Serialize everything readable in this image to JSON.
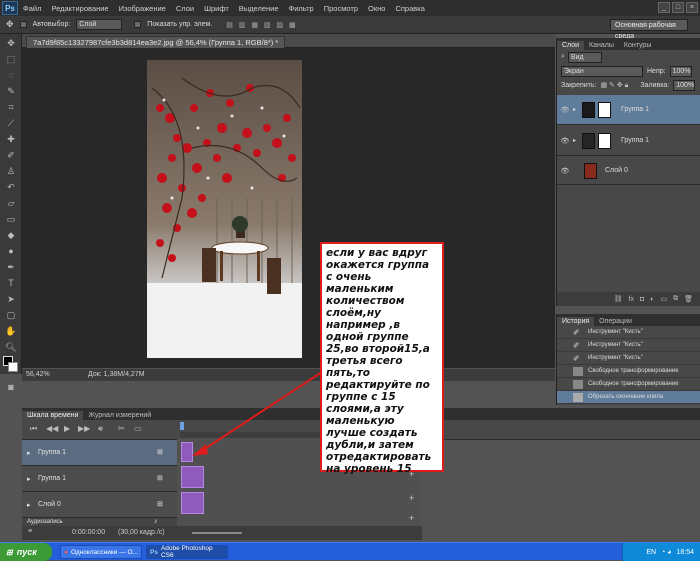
{
  "app": {
    "logo": "Ps"
  },
  "menu": [
    "Файл",
    "Редактирование",
    "Изображение",
    "Слои",
    "Шрифт",
    "Выделение",
    "Фильтр",
    "Просмотр",
    "Окно",
    "Справка"
  ],
  "options_bar": {
    "auto_select_label": "Автовыбор:",
    "auto_select_value": "Слой",
    "show_controls_label": "Показать упр. элем.",
    "workspace": "Основная рабочая среда"
  },
  "document": {
    "tab_title": "7a7d9f85c13327987cfe3b3d814ea3e2.jpg @ 56,4% (Группа 1, RGB/8*) *",
    "zoom": "56,42%",
    "doc_size": "Док: 1,38M/4,27M"
  },
  "layers_panel": {
    "tabs": [
      "Слои",
      "Каналы",
      "Контуры"
    ],
    "kind_label": "Вид",
    "blend_mode": "Экран",
    "opacity_label": "Непр:",
    "opacity_value": "100%",
    "lock_label": "Закрепить:",
    "fill_label": "Заливка:",
    "fill_value": "100%",
    "layers": [
      {
        "name": "Группа 1"
      },
      {
        "name": "Группа 1"
      },
      {
        "name": "Слой 0"
      }
    ],
    "footer_icons": [
      "link-icon",
      "fx-icon",
      "mask-icon",
      "adjustment-icon",
      "folder-icon",
      "new-layer-icon",
      "trash-icon"
    ]
  },
  "history_panel": {
    "tabs": [
      "История",
      "Операции"
    ],
    "items": [
      {
        "label": "Инструмент \"Кисть\"",
        "icon": "brush-icon"
      },
      {
        "label": "Инструмент \"Кисть\"",
        "icon": "brush-icon"
      },
      {
        "label": "Инструмент \"Кисть\"",
        "icon": "brush-icon"
      },
      {
        "label": "Свободное трансформирование",
        "icon": "doc-icon"
      },
      {
        "label": "Свободное трансформирование",
        "icon": "doc-icon"
      },
      {
        "label": "Обрезать окончание клипа",
        "icon": "doc-icon"
      }
    ]
  },
  "timeline": {
    "tabs": [
      "Шкала времени",
      "Журнал измерений"
    ],
    "tracks": [
      {
        "name": "Группа 1"
      },
      {
        "name": "Группа 1"
      },
      {
        "name": "Слой 0"
      }
    ],
    "audio_label": "Аудиозапись",
    "timecode": "0:00:00:00",
    "fps": "(30,00 кадр./с)"
  },
  "annotation": {
    "text": "если у вас вдруг окажется группа с очень маленьким количеством слоём,ну например ,в одной группе 25,во второй15,а третья всего пять,то редактируйте по группе с 15 слоями,а эту маленькую лучше создать дубли,и затем отредактировать на уровень 15",
    "border_color": "#e01b1b"
  },
  "taskbar": {
    "start_label": "пуск",
    "tasks": [
      {
        "label": "Одноклассники — О..."
      },
      {
        "label": "Adobe Photoshop CS6"
      }
    ],
    "lang": "EN",
    "time": "18:54"
  },
  "colors": {
    "accent_selected": "#5f7c9b",
    "clip_purple": "#8f5cbd"
  }
}
